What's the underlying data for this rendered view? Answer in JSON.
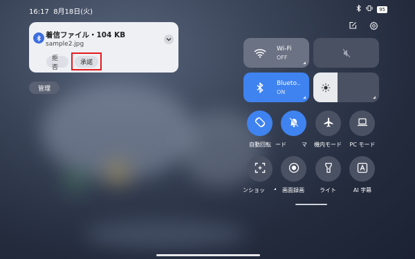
{
  "status": {
    "time": "16:17",
    "date": "8月18日(火)",
    "battery": "95"
  },
  "notification": {
    "title": "着信ファイル・104 KB",
    "filename": "sample2.jpg",
    "reject_label": "拒否",
    "accept_label": "承諾"
  },
  "manage_label": "管理",
  "tiles": {
    "wifi": {
      "label": "Wi-Fi",
      "state": "OFF"
    },
    "bluetooth": {
      "label": "Blueto..",
      "state": "ON"
    },
    "brightness_level": 0.37
  },
  "toggles": [
    {
      "label": "自動回転",
      "icon": "rotate-icon",
      "on": true
    },
    {
      "label": "ード",
      "icon": "bell-off-icon",
      "on": true
    },
    {
      "label": "マ",
      "icon": "",
      "on": false
    },
    {
      "label": "機内モード",
      "icon": "airplane-icon",
      "on": false
    },
    {
      "label": "PC モード",
      "icon": "laptop-icon",
      "on": false
    },
    {
      "label": "ンショッ",
      "icon": "screenshot-icon",
      "on": false
    },
    {
      "label": "画面録画",
      "icon": "screen-record-icon",
      "on": false
    },
    {
      "label": "ライト",
      "icon": "flashlight-icon",
      "on": false
    },
    {
      "label": "AI 字幕",
      "icon": "ai-caption-icon",
      "on": false
    }
  ],
  "colors": {
    "accent": "#3f83f0",
    "highlight": "#e5191c",
    "tile_off": "#4a5163"
  }
}
